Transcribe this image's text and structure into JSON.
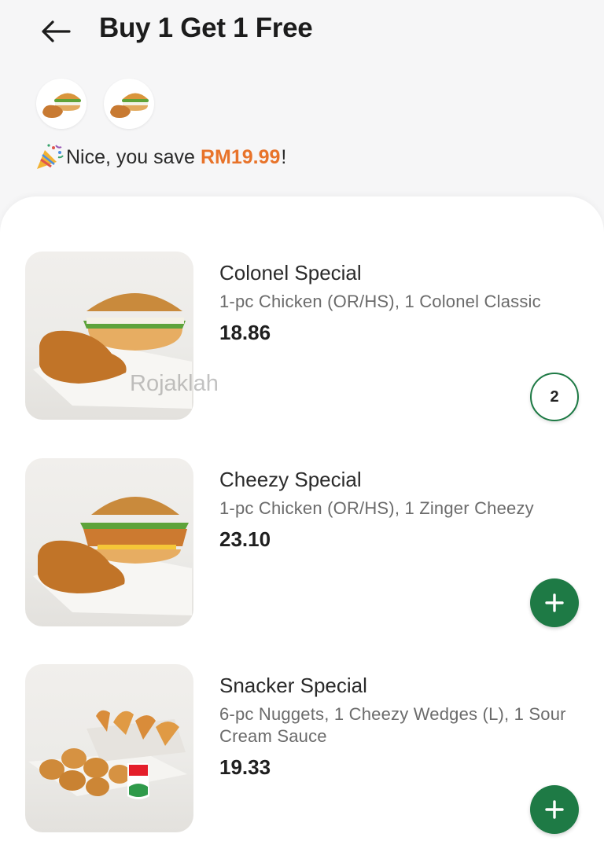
{
  "header": {
    "title": "Buy 1 Get 1 Free",
    "back_icon": "arrow-left-icon"
  },
  "selected_thumbnails": [
    {
      "icon": "combo-burger-chicken-icon"
    },
    {
      "icon": "combo-burger-chicken-icon"
    }
  ],
  "savings": {
    "prefix": "Nice, you save ",
    "amount": "RM19.99",
    "suffix": "!",
    "icon": "party-popper-icon"
  },
  "items": [
    {
      "name": "Colonel Special",
      "desc": "1-pc Chicken (OR/HS), 1 Colonel Classic",
      "price": "18.86",
      "quantity": "2"
    },
    {
      "name": "Cheezy Special",
      "desc": "1-pc Chicken (OR/HS), 1 Zinger Cheezy",
      "price": "23.10",
      "add_icon": "plus-icon"
    },
    {
      "name": "Snacker Special",
      "desc": "6-pc Nuggets, 1 Cheezy Wedges (L), 1 Sour Cream Sauce",
      "price": "19.33",
      "add_icon": "plus-icon"
    }
  ],
  "watermark": "Rojaklah",
  "colors": {
    "accent_green": "#1e7a45",
    "savings_orange": "#e8732a"
  }
}
